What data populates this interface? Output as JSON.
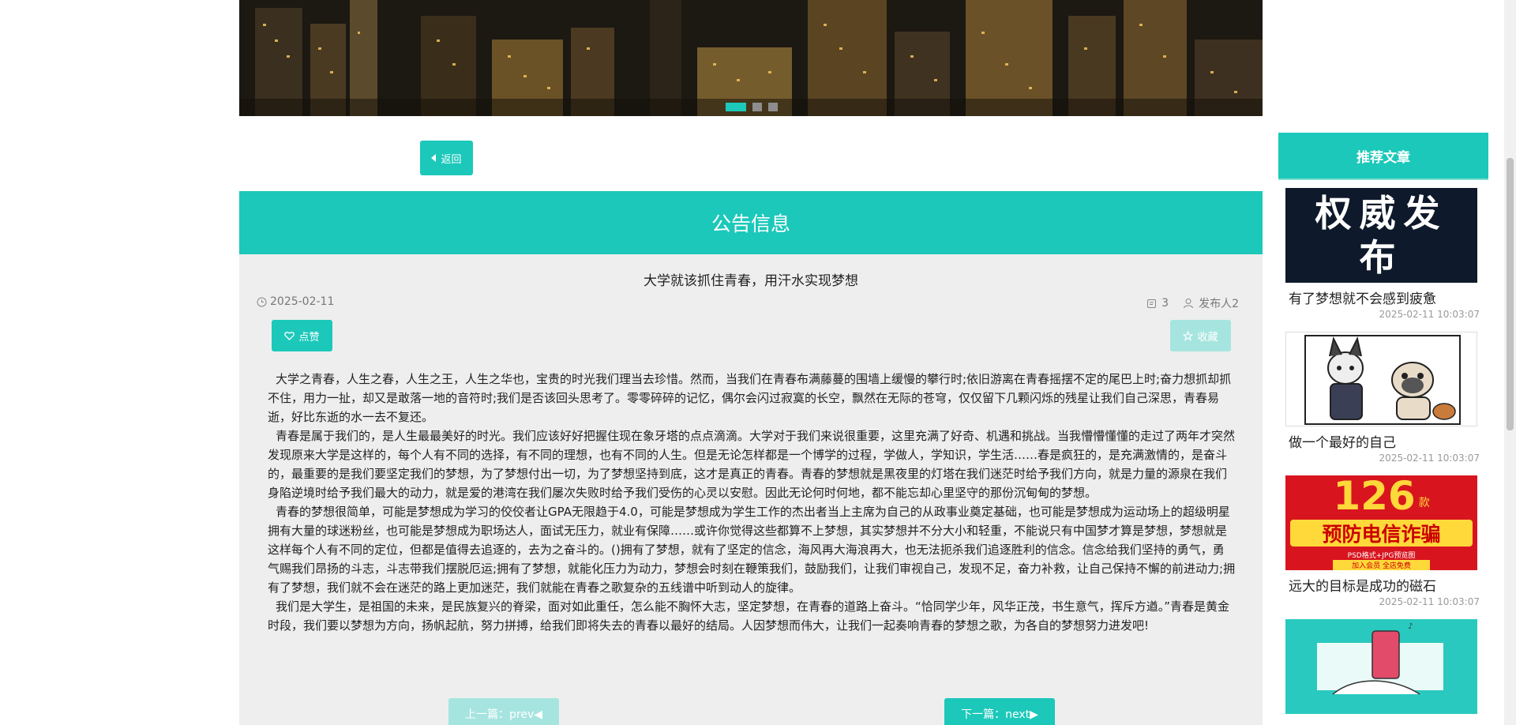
{
  "banner": {
    "slide_count": 3,
    "active_slide": 1
  },
  "back_button": {
    "label": "返回"
  },
  "main": {
    "header_title": "公告信息",
    "article_title": "大学就该抓住青春，用汗水实现梦想",
    "date": "2025-02-11",
    "comment_count": "3",
    "author": "发布人2",
    "like_label": "点赞",
    "favorite_label": "收藏",
    "paragraphs": [
      "大学之青春，人生之春，人生之王，人生之华也，宝贵的时光我们理当去珍惜。然而，当我们在青春布满藤蔓的围墙上缓慢的攀行时;依旧游离在青春摇摆不定的尾巴上时;奋力想抓却抓不住，用力一扯，却又是敢落一地的音符时;我们是否该回头思考了。零零碎碎的记忆，偶尔会闪过寂寞的长空，飘然在无际的苍穹，仅仅留下几颗闪烁的残星让我们自己深思，青春易逝，好比东逝的水一去不复还。",
      "青春是属于我们的，是人生最最美好的时光。我们应该好好把握住现在象牙塔的点点滴滴。大学对于我们来说很重要，这里充满了好奇、机遇和挑战。当我懵懵懂懂的走过了两年才突然发现原来大学是这样的，每个人有不同的选择，有不同的理想，也有不同的人生。但是无论怎样都是一个博学的过程，学做人，学知识，学生活……春是疯狂的，是充满激情的，是奋斗的，最重要的是我们要坚定我们的梦想，为了梦想付出一切，为了梦想坚持到底，这才是真正的青春。青春的梦想就是黑夜里的灯塔在我们迷茫时给予我们方向，就是力量的源泉在我们身陷逆境时给予我们最大的动力，就是爱的港湾在我们屡次失败时给予我们受伤的心灵以安慰。因此无论何时何地，都不能忘却心里坚守的那份沉甸甸的梦想。",
      "青春的梦想很简单，可能是梦想成为学习的佼佼者让GPA无限趋于4.0，可能是梦想成为学生工作的杰出者当上主席为自己的从政事业奠定基础，也可能是梦想成为运动场上的超级明星拥有大量的球迷粉丝，也可能是梦想成为职场达人，面试无压力，就业有保障……或许你觉得这些都算不上梦想，其实梦想并不分大小和轻重，不能说只有中国梦才算是梦想，梦想就是这样每个人有不同的定位，但都是值得去追逐的，去为之奋斗的。()拥有了梦想，就有了坚定的信念，海风再大海浪再大，也无法扼杀我们追逐胜利的信念。信念给我们坚持的勇气，勇气赐我们昂扬的斗志，斗志带我们摆脱厄运;拥有了梦想，就能化压力为动力，梦想会时刻在鞭策我们，鼓励我们，让我们审视自己，发现不足，奋力补救，让自己保持不懈的前进动力;拥有了梦想，我们就不会在迷茫的路上更加迷茫，我们就能在青春之歌复杂的五线谱中听到动人的旋律。",
      "我们是大学生，是祖国的未来，是民族复兴的脊梁，面对如此重任，怎么能不胸怀大志，坚定梦想，在青春的道路上奋斗。“恰同学少年，风华正茂，书生意气，挥斥方遒。”青春是黄金时段，我们要以梦想为方向，扬帆起航，努力拼搏，给我们即将失去的青春以最好的结局。人因梦想而伟大，让我们一起奏响青春的梦想之歌，为各自的梦想努力进发吧!"
    ],
    "prev_label": "上一篇：prev◀",
    "next_label": "下一篇：next▶"
  },
  "sidebar": {
    "title": "推荐文章",
    "items": [
      {
        "title": "有了梦想就不会感到疲惫",
        "date": "2025-02-11 10:03:07",
        "thumb_text": "权威发布"
      },
      {
        "title": "做一个最好的自己",
        "date": "2025-02-11 10:03:07"
      },
      {
        "title": "远大的目标是成功的磁石",
        "date": "2025-02-11 10:03:07",
        "thumb_big": "126",
        "thumb_unit": "款",
        "thumb_main": "预防电信诈骗",
        "thumb_small": "PSD格式+JPG预览图",
        "thumb_foot": "加入会员 全店免费"
      },
      {
        "title": "",
        "date": ""
      }
    ]
  },
  "colors": {
    "accent": "#1cc8ba",
    "accent_light": "#a6e5df",
    "panel": "#eeeeee"
  }
}
